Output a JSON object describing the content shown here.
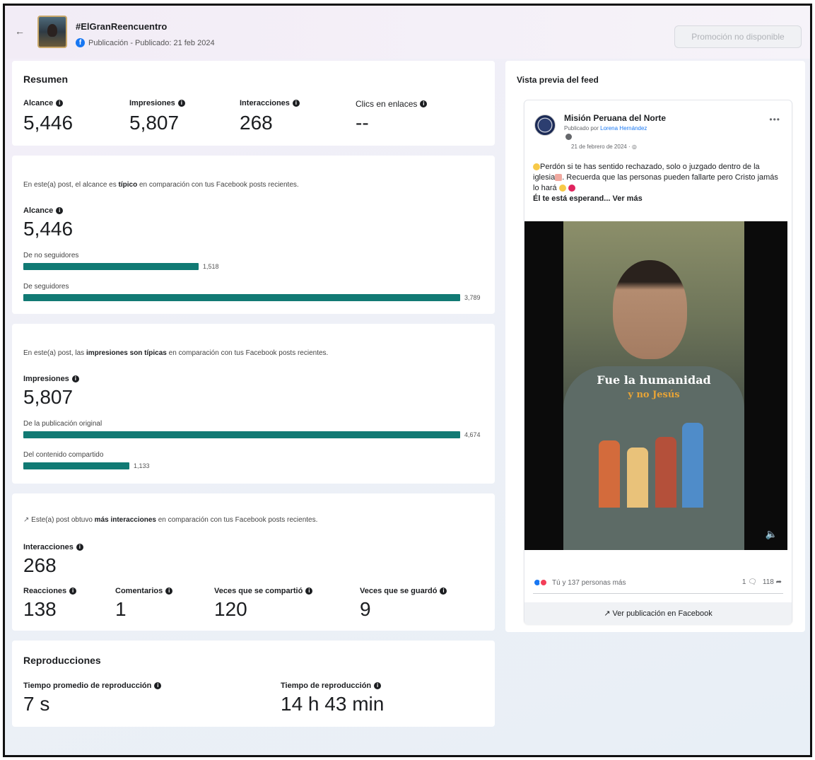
{
  "header": {
    "back_icon": "back-arrow-icon",
    "title": "#ElGranReencuentro",
    "subtitle": "Publicación - Publicado: 21 feb 2024",
    "promo_button": "Promoción no disponible"
  },
  "resumen": {
    "title": "Resumen",
    "metrics": [
      {
        "label": "Alcance",
        "value": "5,446"
      },
      {
        "label": "Impresiones",
        "value": "5,807"
      },
      {
        "label": "Interacciones",
        "value": "268"
      },
      {
        "label": "Clics en enlaces",
        "value": "--"
      }
    ]
  },
  "alcance": {
    "desc_pre": "En este(a) post, el alcance es ",
    "desc_bold": "típico",
    "desc_post": " en comparación con tus Facebook posts recientes.",
    "label": "Alcance",
    "value": "5,446",
    "bars": [
      {
        "label": "De no seguidores",
        "value": "1,518",
        "amount": 1518
      },
      {
        "label": "De seguidores",
        "value": "3,789",
        "amount": 3789
      }
    ]
  },
  "impresiones": {
    "desc_pre": "En este(a) post, las ",
    "desc_bold": "impresiones son típicas",
    "desc_post": " en comparación con tus Facebook posts recientes.",
    "label": "Impresiones",
    "value": "5,807",
    "bars": [
      {
        "label": "De la publicación original",
        "value": "4,674",
        "amount": 4674
      },
      {
        "label": "Del contenido compartido",
        "value": "1,133",
        "amount": 1133
      }
    ]
  },
  "interacciones": {
    "desc_pre": "Este(a) post obtuvo ",
    "desc_bold": "más interacciones",
    "desc_post": " en comparación con tus Facebook posts recientes.",
    "label": "Interacciones",
    "value": "268",
    "sub": [
      {
        "label": "Reacciones",
        "value": "138"
      },
      {
        "label": "Comentarios",
        "value": "1"
      },
      {
        "label": "Veces que se compartió",
        "value": "120"
      },
      {
        "label": "Veces que se guardó",
        "value": "9"
      }
    ]
  },
  "reproducciones": {
    "title": "Reproducciones",
    "metrics": [
      {
        "label": "Tiempo promedio de reproducción",
        "value": "7 s"
      },
      {
        "label": "Tiempo de reproducción",
        "value": "14 h 43 min"
      }
    ]
  },
  "preview": {
    "title": "Vista previa del feed",
    "page_name": "Misión Peruana del Norte",
    "published_by_prefix": "Publicado por ",
    "published_by_name": "Lorena Hernández",
    "date": "21 de febrero de 2024 · ",
    "text_line1": "Perdón si te has sentido rechazado, solo o juzgado dentro de la iglesia",
    "text_line2": ". Recuerda que las personas pueden fallarte pero Cristo jamás lo hará ",
    "text_line3": "Él te está esperand... ",
    "see_more": "Ver más",
    "video_caption_1": "Fue la humanidad",
    "video_caption_2": "y no Jesús",
    "reactions_text": "Tú y 137 personas más",
    "comments_count": "1",
    "shares_count": "118",
    "view_on_fb": "Ver publicación en Facebook"
  },
  "colors": {
    "bar": "#117a74",
    "facebook_blue": "#1877f2"
  }
}
